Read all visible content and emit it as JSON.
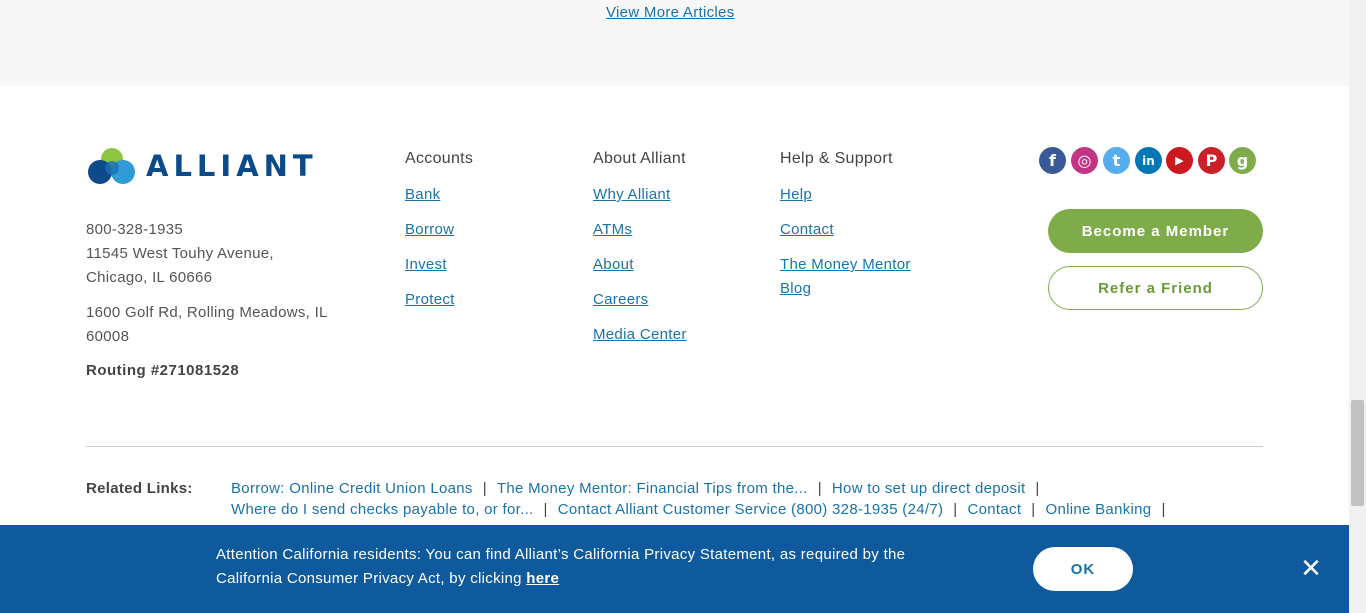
{
  "top": {
    "view_more": "View More Articles"
  },
  "logo": {
    "text": "ALLIANT"
  },
  "contact": {
    "phone": "800-328-1935",
    "address1_line1": "11545 West Touhy Avenue,",
    "address1_line2": "Chicago, IL 60666",
    "address2_line1": "1600 Golf Rd, Rolling Meadows, IL",
    "address2_line2": "60008",
    "routing": "Routing #271081528"
  },
  "columns": [
    {
      "title": "Accounts",
      "links": [
        "Bank",
        "Borrow",
        "Invest",
        "Protect"
      ]
    },
    {
      "title": "About Alliant",
      "links": [
        "Why Alliant",
        "ATMs",
        "About",
        "Careers",
        "Media Center"
      ]
    },
    {
      "title": "Help & Support",
      "links": [
        "Help",
        "Contact",
        "The Money Mentor",
        "Blog"
      ]
    }
  ],
  "social": [
    {
      "icon": "facebook-icon",
      "glyph": "f",
      "color": "#3b5998"
    },
    {
      "icon": "instagram-icon",
      "glyph": "◎",
      "color": "#c13584"
    },
    {
      "icon": "twitter-icon",
      "glyph": "t",
      "color": "#55acee"
    },
    {
      "icon": "linkedin-icon",
      "glyph": "in",
      "color": "#0077b5"
    },
    {
      "icon": "youtube-icon",
      "glyph": "▶",
      "color": "#cc181e"
    },
    {
      "icon": "pinterest-icon",
      "glyph": "P",
      "color": "#cb2027"
    },
    {
      "icon": "glassdoor-icon",
      "glyph": "g",
      "color": "#7fac4b"
    }
  ],
  "buttons": {
    "member": "Become a Member",
    "refer": "Refer a Friend"
  },
  "related": {
    "label": "Related Links:",
    "row1": [
      "Borrow: Online Credit Union Loans",
      "The Money Mentor: Financial Tips from the...",
      "How to set up direct deposit"
    ],
    "row2": [
      "Where do I send checks payable to, or for...",
      "Contact Alliant Customer Service (800) 328-1935 (24/7)",
      "Contact",
      "Online Banking"
    ]
  },
  "banner": {
    "text_line1": "Attention California residents: You can find Alliant’s California Privacy Statement, as required by the",
    "text_line2_prefix": "California Consumer Privacy Act, by clicking ",
    "link": "here",
    "ok": "OK"
  },
  "colors": {
    "brand_blue": "#0c4a8a",
    "link": "#1a73a8",
    "green": "#7fac4b",
    "banner": "#0f5a9c"
  }
}
